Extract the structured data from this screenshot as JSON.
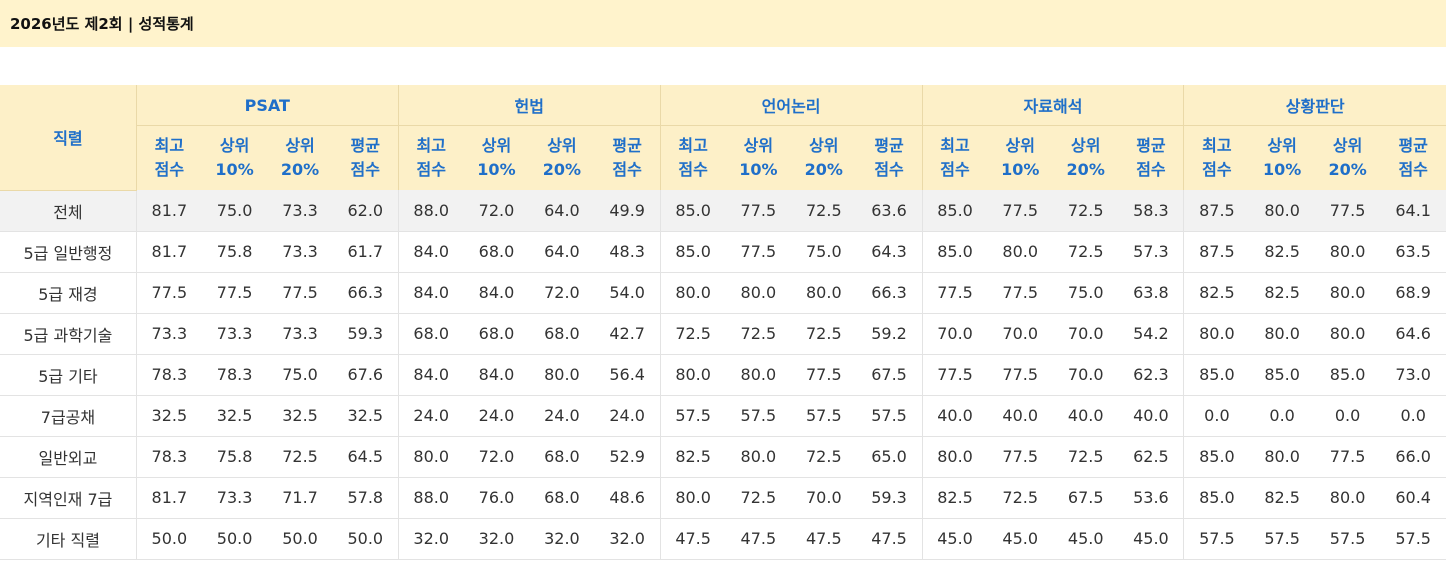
{
  "title": "2026년도 제2회 | 성적통계",
  "job_header": "직렬",
  "subjects": [
    "PSAT",
    "헌법",
    "언어논리",
    "자료해석",
    "상황판단"
  ],
  "metrics": [
    {
      "line1": "최고",
      "line2": "점수"
    },
    {
      "line1": "상위",
      "line2": "10%"
    },
    {
      "line1": "상위",
      "line2": "20%"
    },
    {
      "line1": "평균",
      "line2": "점수"
    }
  ],
  "rows": [
    {
      "job": "전체",
      "values": [
        "81.7",
        "75.0",
        "73.3",
        "62.0",
        "88.0",
        "72.0",
        "64.0",
        "49.9",
        "85.0",
        "77.5",
        "72.5",
        "63.6",
        "85.0",
        "77.5",
        "72.5",
        "58.3",
        "87.5",
        "80.0",
        "77.5",
        "64.1"
      ]
    },
    {
      "job": "5급 일반행정",
      "values": [
        "81.7",
        "75.8",
        "73.3",
        "61.7",
        "84.0",
        "68.0",
        "64.0",
        "48.3",
        "85.0",
        "77.5",
        "75.0",
        "64.3",
        "85.0",
        "80.0",
        "72.5",
        "57.3",
        "87.5",
        "82.5",
        "80.0",
        "63.5"
      ]
    },
    {
      "job": "5급 재경",
      "values": [
        "77.5",
        "77.5",
        "77.5",
        "66.3",
        "84.0",
        "84.0",
        "72.0",
        "54.0",
        "80.0",
        "80.0",
        "80.0",
        "66.3",
        "77.5",
        "77.5",
        "75.0",
        "63.8",
        "82.5",
        "82.5",
        "80.0",
        "68.9"
      ]
    },
    {
      "job": "5급 과학기술",
      "values": [
        "73.3",
        "73.3",
        "73.3",
        "59.3",
        "68.0",
        "68.0",
        "68.0",
        "42.7",
        "72.5",
        "72.5",
        "72.5",
        "59.2",
        "70.0",
        "70.0",
        "70.0",
        "54.2",
        "80.0",
        "80.0",
        "80.0",
        "64.6"
      ]
    },
    {
      "job": "5급 기타",
      "values": [
        "78.3",
        "78.3",
        "75.0",
        "67.6",
        "84.0",
        "84.0",
        "80.0",
        "56.4",
        "80.0",
        "80.0",
        "77.5",
        "67.5",
        "77.5",
        "77.5",
        "70.0",
        "62.3",
        "85.0",
        "85.0",
        "85.0",
        "73.0"
      ]
    },
    {
      "job": "7급공채",
      "values": [
        "32.5",
        "32.5",
        "32.5",
        "32.5",
        "24.0",
        "24.0",
        "24.0",
        "24.0",
        "57.5",
        "57.5",
        "57.5",
        "57.5",
        "40.0",
        "40.0",
        "40.0",
        "40.0",
        "0.0",
        "0.0",
        "0.0",
        "0.0"
      ]
    },
    {
      "job": "일반외교",
      "values": [
        "78.3",
        "75.8",
        "72.5",
        "64.5",
        "80.0",
        "72.0",
        "68.0",
        "52.9",
        "82.5",
        "80.0",
        "72.5",
        "65.0",
        "80.0",
        "77.5",
        "72.5",
        "62.5",
        "85.0",
        "80.0",
        "77.5",
        "66.0"
      ]
    },
    {
      "job": "지역인재 7급",
      "values": [
        "81.7",
        "73.3",
        "71.7",
        "57.8",
        "88.0",
        "76.0",
        "68.0",
        "48.6",
        "80.0",
        "72.5",
        "70.0",
        "59.3",
        "82.5",
        "72.5",
        "67.5",
        "53.6",
        "85.0",
        "82.5",
        "80.0",
        "60.4"
      ]
    },
    {
      "job": "기타 직렬",
      "values": [
        "50.0",
        "50.0",
        "50.0",
        "50.0",
        "32.0",
        "32.0",
        "32.0",
        "32.0",
        "47.5",
        "47.5",
        "47.5",
        "47.5",
        "45.0",
        "45.0",
        "45.0",
        "45.0",
        "57.5",
        "57.5",
        "57.5",
        "57.5"
      ]
    }
  ],
  "colors": {
    "title_bg": "#fff3cc",
    "header_bg": "#fdf0c8",
    "header_text": "#1f6fc9",
    "first_row_bg": "#f2f2f2"
  }
}
